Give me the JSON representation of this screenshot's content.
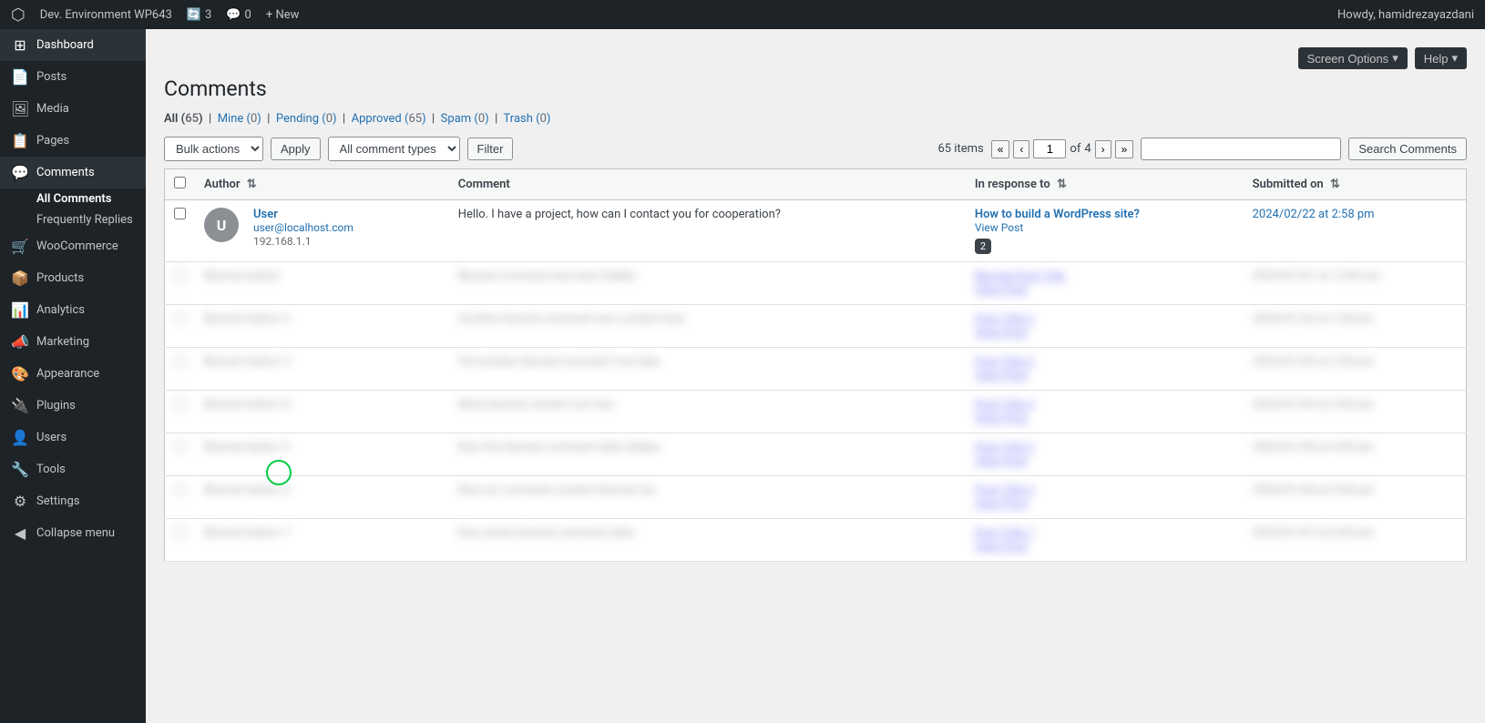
{
  "adminbar": {
    "site_name": "Dev. Environment WP643",
    "updates_count": "3",
    "comments_count": "0",
    "new_label": "+ New",
    "howdy": "Howdy, hamidrezayazdani"
  },
  "top_buttons": {
    "screen_options": "Screen Options",
    "help": "Help"
  },
  "sidebar": {
    "items": [
      {
        "id": "dashboard",
        "label": "Dashboard",
        "icon": "⊞"
      },
      {
        "id": "posts",
        "label": "Posts",
        "icon": "📄"
      },
      {
        "id": "media",
        "label": "Media",
        "icon": "🖼"
      },
      {
        "id": "pages",
        "label": "Pages",
        "icon": "📋"
      },
      {
        "id": "comments",
        "label": "Comments",
        "icon": "💬",
        "active": true
      },
      {
        "id": "woocommerce",
        "label": "WooCommerce",
        "icon": "🛒"
      },
      {
        "id": "products",
        "label": "Products",
        "icon": "📦"
      },
      {
        "id": "analytics",
        "label": "Analytics",
        "icon": "📊"
      },
      {
        "id": "marketing",
        "label": "Marketing",
        "icon": "📣"
      },
      {
        "id": "appearance",
        "label": "Appearance",
        "icon": "🎨"
      },
      {
        "id": "plugins",
        "label": "Plugins",
        "icon": "🔌"
      },
      {
        "id": "users",
        "label": "Users",
        "icon": "👤"
      },
      {
        "id": "tools",
        "label": "Tools",
        "icon": "🔧"
      },
      {
        "id": "settings",
        "label": "Settings",
        "icon": "⚙"
      },
      {
        "id": "collapse",
        "label": "Collapse menu",
        "icon": "◀"
      }
    ],
    "sub_items": [
      {
        "id": "all-comments",
        "label": "All Comments",
        "active": true
      },
      {
        "id": "frequently-replies",
        "label": "Frequently Replies"
      }
    ]
  },
  "page": {
    "title": "Comments"
  },
  "filter_tabs": {
    "all": {
      "label": "All",
      "count": "65",
      "current": true
    },
    "mine": {
      "label": "Mine",
      "count": "0"
    },
    "pending": {
      "label": "Pending",
      "count": "0"
    },
    "approved": {
      "label": "Approved",
      "count": "65"
    },
    "spam": {
      "label": "Spam",
      "count": "0"
    },
    "trash": {
      "label": "Trash",
      "count": "0"
    }
  },
  "toolbar": {
    "bulk_actions_label": "Bulk actions",
    "apply_label": "Apply",
    "comment_types_label": "All comment types",
    "filter_label": "Filter",
    "items_count": "65 items",
    "page_current": "1",
    "page_total": "4"
  },
  "search": {
    "placeholder": "",
    "button_label": "Search Comments"
  },
  "table": {
    "columns": {
      "author": "Author",
      "comment": "Comment",
      "in_response_to": "In response to",
      "submitted_on": "Submitted on"
    },
    "visible_row": {
      "author_name": "User",
      "author_email": "user@localhost.com",
      "author_ip": "192.168.1.1",
      "avatar_letter": "U",
      "comment_text": "Hello. I have a project, how can I contact you for cooperation?",
      "in_response_post": "How to build a WordPress site?",
      "view_post_label": "View Post",
      "comment_count": "2",
      "submitted_date": "2024/02/22 at 2:58 pm"
    }
  }
}
